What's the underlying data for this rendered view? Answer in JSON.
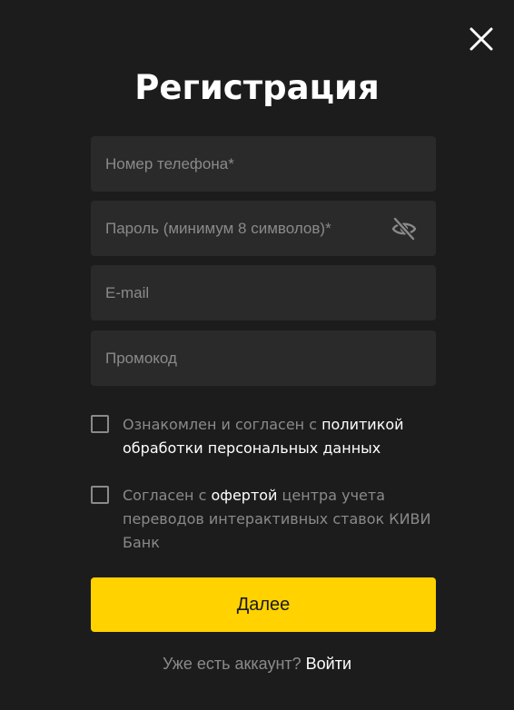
{
  "modal": {
    "title": "Регистрация",
    "close_icon": "close-icon"
  },
  "fields": {
    "phone": {
      "placeholder": "Номер телефона*",
      "value": ""
    },
    "password": {
      "placeholder": "Пароль (минимум 8 символов)*",
      "value": "",
      "toggle_icon": "eye-slash-icon"
    },
    "email": {
      "placeholder": "E-mail",
      "value": ""
    },
    "promo": {
      "placeholder": "Промокод",
      "value": ""
    }
  },
  "consents": {
    "privacy": {
      "text_before": "Ознакомлен и согласен с ",
      "link_text": "политикой обработки персональных данных",
      "text_after": "",
      "checked": false
    },
    "offer": {
      "text_before": "Согласен с ",
      "link_text": "офертой",
      "text_after": " центра учета переводов интерактивных ставок КИВИ Банк",
      "checked": false
    }
  },
  "actions": {
    "submit_label": "Далее",
    "login_prompt": "Уже есть аккаунт?",
    "login_link": "Войти"
  },
  "colors": {
    "background": "#1c1c1c",
    "field_bg": "#2a2a2a",
    "accent": "#ffd200",
    "muted_text": "#8a8a8a",
    "text": "#ffffff"
  }
}
